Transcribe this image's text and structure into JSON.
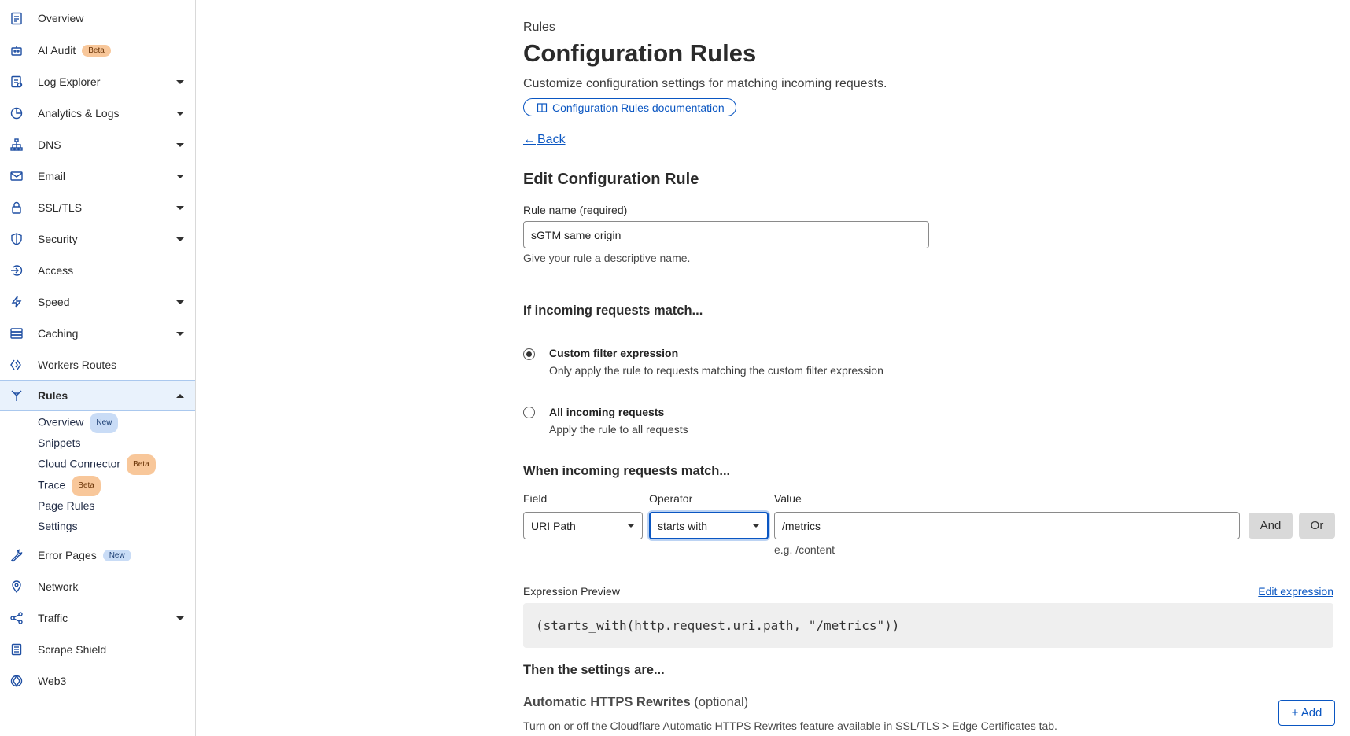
{
  "sidebar": {
    "items": [
      {
        "label": "Overview",
        "icon": "clipboard-icon"
      },
      {
        "label": "AI Audit",
        "badge": "Beta",
        "icon": "robot-icon"
      },
      {
        "label": "Log Explorer",
        "icon": "log-icon"
      },
      {
        "label": "Analytics & Logs",
        "icon": "pie-chart-icon"
      },
      {
        "label": "DNS",
        "icon": "network-tree-icon"
      },
      {
        "label": "Email",
        "icon": "envelope-icon"
      },
      {
        "label": "SSL/TLS",
        "icon": "lock-icon"
      },
      {
        "label": "Security",
        "icon": "shield-icon"
      },
      {
        "label": "Access",
        "icon": "access-icon"
      },
      {
        "label": "Speed",
        "icon": "lightning-icon"
      },
      {
        "label": "Caching",
        "icon": "server-stack-icon"
      },
      {
        "label": "Workers Routes",
        "icon": "workers-icon"
      },
      {
        "label": "Rules",
        "icon": "funnel-icon"
      },
      {
        "label": "Error Pages",
        "badge": "New",
        "icon": "wrench-icon"
      },
      {
        "label": "Network",
        "icon": "location-pin-icon"
      },
      {
        "label": "Traffic",
        "icon": "traffic-icon"
      },
      {
        "label": "Scrape Shield",
        "icon": "document-icon"
      },
      {
        "label": "Web3",
        "icon": "web3-icon"
      }
    ],
    "rules_sub": [
      {
        "label": "Overview",
        "badge": "New"
      },
      {
        "label": "Snippets"
      },
      {
        "label": "Cloud Connector",
        "badge": "Beta"
      },
      {
        "label": "Trace",
        "badge": "Beta"
      },
      {
        "label": "Page Rules"
      },
      {
        "label": "Settings"
      }
    ]
  },
  "header": {
    "breadcrumb": "Rules",
    "title": "Configuration Rules",
    "subtitle": "Customize configuration settings for matching incoming requests.",
    "docs_link": "Configuration Rules documentation",
    "back": "Back"
  },
  "form": {
    "heading": "Edit Configuration Rule",
    "rule_name_label": "Rule name (required)",
    "rule_name_value": "sGTM same origin",
    "rule_name_help": "Give your rule a descriptive name.",
    "match_heading": "If incoming requests match...",
    "option_custom_title": "Custom filter expression",
    "option_custom_desc": "Only apply the rule to requests matching the custom filter expression",
    "option_all_title": "All incoming requests",
    "option_all_desc": "Apply the rule to all requests",
    "when_heading": "When incoming requests match...",
    "field_label": "Field",
    "field_value": "URI Path",
    "operator_label": "Operator",
    "operator_value": "starts with",
    "value_label": "Value",
    "value_value": "/metrics",
    "value_hint": "e.g. /content",
    "and_label": "And",
    "or_label": "Or",
    "expr_label": "Expression Preview",
    "edit_expression": "Edit expression",
    "expression": "(starts_with(http.request.uri.path, \"/metrics\"))",
    "then_heading": "Then the settings are...",
    "setting_title": "Automatic HTTPS Rewrites",
    "setting_optional": "(optional)",
    "setting_desc": "Turn on or off the Cloudflare Automatic HTTPS Rewrites feature available in SSL/TLS > Edge Certificates tab.",
    "add_label": "+ Add"
  },
  "colors": {
    "accent": "#0a56c2",
    "active_bg": "#e9f2fc",
    "beta_badge": "#f8c79a",
    "new_badge": "#c9dcf6"
  }
}
